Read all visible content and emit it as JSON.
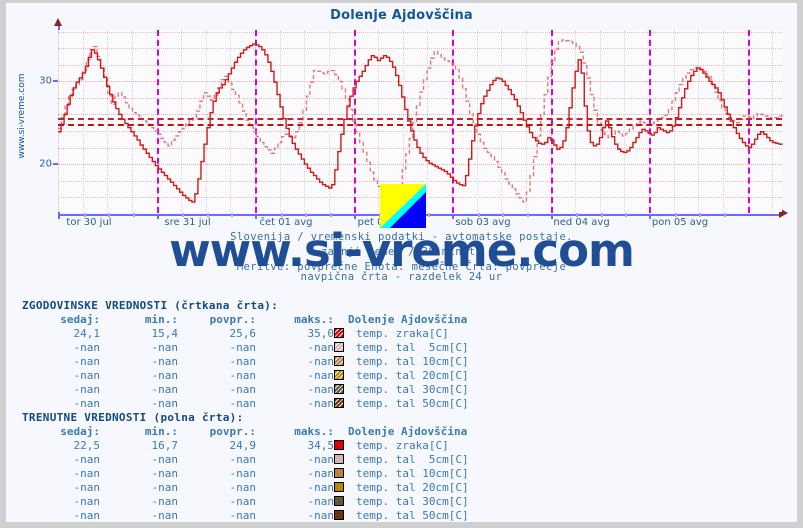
{
  "page": {
    "title": "Dolenje Ajdovščina",
    "vertical_watermark": "www.si-vreme.com",
    "watermark": "www.si-vreme.com"
  },
  "subtitle": {
    "line1": "Slovenija / vremenski podatki - avtomatske postaje.",
    "line2": "zadnji teden / 30 minut.",
    "line3": "Meritve: povprečne  Enota: mesečne  Črta: povprečje",
    "line4": "navpična črta - razdelek 24 ur"
  },
  "chart_data": {
    "type": "line",
    "title": "Dolenje Ajdovščina",
    "xlabel": "",
    "ylabel": "temp. zraka[C]",
    "ylim": [
      14.2,
      36.2
    ],
    "yticks": [
      20,
      30
    ],
    "ytick_labels": [
      "20",
      "30"
    ],
    "grid": true,
    "legend_position": "below-table",
    "x_tick_labels": [
      "tor 30 jul",
      "sre 31 jul",
      "čet 01 avg",
      "pet 02 avg",
      "sob 03 avg",
      "ned 04 avg",
      "pon 05 avg"
    ],
    "day_separator_note": "navpična črta - razdelek 24 ur",
    "average_lines": [
      {
        "name": "zgodovinsko povprečje",
        "value": 25.6,
        "style": "dashed",
        "color": "#cc2222"
      },
      {
        "name": "trenutno povprečje",
        "value": 24.9,
        "style": "dashed",
        "color": "#bb1414"
      }
    ],
    "series": [
      {
        "name": "temp. zraka[C] - zgodovinske vrednosti",
        "style": "dashed",
        "color": "#e87878",
        "values": [
          24.3,
          25.6,
          27.0,
          28.1,
          29.0,
          29.6,
          30.2,
          31.3,
          32.6,
          33.8,
          34.2,
          33.0,
          31.6,
          30.3,
          28.6,
          27.2,
          28.2,
          28.6,
          28.1,
          27.4,
          26.7,
          26.2,
          25.9,
          25.5,
          25.2,
          24.8,
          24.4,
          24.0,
          23.6,
          23.1,
          22.6,
          22.2,
          22.9,
          23.4,
          23.9,
          24.3,
          24.8,
          25.3,
          25.6,
          26.4,
          27.6,
          28.6,
          28.2,
          27.7,
          28.3,
          29.2,
          30.2,
          30.6,
          29.8,
          29.0,
          28.3,
          27.4,
          26.4,
          25.3,
          24.5,
          23.9,
          23.3,
          22.6,
          22.1,
          21.7,
          21.3,
          21.9,
          22.6,
          23.3,
          23.6,
          23.4,
          23.2,
          23.9,
          25.0,
          26.5,
          28.2,
          29.9,
          31.3,
          31.2,
          31.0,
          30.9,
          31.2,
          31.3,
          30.8,
          30.0,
          29.1,
          27.9,
          26.6,
          25.2,
          23.9,
          22.6,
          21.4,
          20.2,
          19.0,
          18.1,
          17.3,
          16.6,
          15.8,
          15.2,
          14.9,
          15.8,
          17.4,
          19.3,
          21.2,
          23.1,
          25.0,
          27.0,
          28.7,
          30.2,
          31.6,
          32.8,
          33.6,
          33.2,
          32.8,
          32.5,
          32.4,
          32.1,
          31.4,
          30.4,
          29.1,
          27.6,
          26.1,
          24.8,
          23.6,
          22.6,
          21.9,
          21.4,
          20.9,
          20.3,
          19.6,
          18.9,
          18.2,
          17.6,
          17.0,
          16.4,
          15.9,
          15.4,
          16.6,
          18.6,
          20.9,
          23.4,
          26.0,
          28.4,
          30.5,
          32.3,
          33.9,
          34.8,
          35.0,
          34.9,
          34.8,
          34.6,
          34.2,
          33.5,
          32.2,
          30.4,
          28.4,
          26.5,
          25.0,
          24.1,
          23.6,
          23.2,
          23.6,
          24.0,
          23.8,
          23.4,
          23.7,
          24.2,
          24.6,
          24.9,
          25.2,
          25.0,
          24.8,
          24.9,
          25.2,
          25.5,
          25.6,
          25.9,
          26.6,
          27.6,
          28.6,
          29.6,
          30.4,
          31.0,
          31.4,
          31.6,
          31.7,
          31.5,
          31.2,
          30.6,
          29.7,
          28.7,
          27.7,
          26.8,
          26.1,
          25.6,
          25.2,
          25.0,
          25.4,
          25.8,
          25.7,
          25.5,
          25.8,
          26.1,
          26.0,
          25.8,
          25.6,
          25.5,
          25.6,
          25.8,
          26.0
        ]
      },
      {
        "name": "temp. zraka[C] - trenutne vrednosti",
        "style": "solid",
        "color": "#d41919",
        "values": [
          23.9,
          24.8,
          26.0,
          27.2,
          28.3,
          29.2,
          29.9,
          30.4,
          31.0,
          31.8,
          32.9,
          33.8,
          33.4,
          32.6,
          31.6,
          30.5,
          29.4,
          28.4,
          27.5,
          26.7,
          26.0,
          25.4,
          24.9,
          24.4,
          23.9,
          23.4,
          22.9,
          22.3,
          21.8,
          21.3,
          20.8,
          20.3,
          19.8,
          19.4,
          19.0,
          18.6,
          18.2,
          17.8,
          17.4,
          17.0,
          16.6,
          16.2,
          15.9,
          15.6,
          15.4,
          16.4,
          18.2,
          20.3,
          22.4,
          24.4,
          26.2,
          27.6,
          28.6,
          29.2,
          29.6,
          30.2,
          30.9,
          31.6,
          32.3,
          32.9,
          33.4,
          33.8,
          34.1,
          34.3,
          34.5,
          34.4,
          34.2,
          33.8,
          33.2,
          32.3,
          31.2,
          29.9,
          28.4,
          26.9,
          25.5,
          24.3,
          23.3,
          22.5,
          21.8,
          21.2,
          20.6,
          20.0,
          19.5,
          19.0,
          18.6,
          18.2,
          17.8,
          17.5,
          17.3,
          17.1,
          17.5,
          19.3,
          21.5,
          23.6,
          25.4,
          27.0,
          28.2,
          29.2,
          30.0,
          30.6,
          31.2,
          31.9,
          32.6,
          33.1,
          32.9,
          32.5,
          32.8,
          33.1,
          32.9,
          32.4,
          31.7,
          30.7,
          29.5,
          28.1,
          26.6,
          25.2,
          24.0,
          22.9,
          22.0,
          21.3,
          20.8,
          20.4,
          20.1,
          19.9,
          19.7,
          19.5,
          19.3,
          19.1,
          18.8,
          18.4,
          18.0,
          17.7,
          17.5,
          17.4,
          18.6,
          20.6,
          22.8,
          24.6,
          26.1,
          27.3,
          28.2,
          28.9,
          29.6,
          30.1,
          30.4,
          30.3,
          30.0,
          29.5,
          29.0,
          28.4,
          27.8,
          27.0,
          26.2,
          25.3,
          24.5,
          23.8,
          23.2,
          22.8,
          22.5,
          22.4,
          22.6,
          23.2,
          22.9,
          22.3,
          21.8,
          22.0,
          22.8,
          24.4,
          26.8,
          29.2,
          31.2,
          32.6,
          31.0,
          27.0,
          24.0,
          22.6,
          22.2,
          22.4,
          23.2,
          24.4,
          25.2,
          24.4,
          23.3,
          22.4,
          21.8,
          21.5,
          21.4,
          21.6,
          22.0,
          22.6,
          23.2,
          23.8,
          24.2,
          24.0,
          23.7,
          23.5,
          23.8,
          24.4,
          24.2,
          24.0,
          23.8,
          24.0,
          24.6,
          25.6,
          26.8,
          28.0,
          29.1,
          30.0,
          30.7,
          31.2,
          31.6,
          31.4,
          31.0,
          30.5,
          30.0,
          29.6,
          29.2,
          28.6,
          27.8,
          26.9,
          26.0,
          25.2,
          24.4,
          23.7,
          23.1,
          22.6,
          22.2,
          22.0,
          22.4,
          23.0,
          23.6,
          23.9,
          23.6,
          23.2,
          22.8,
          22.6,
          22.5,
          22.4,
          22.5
        ]
      }
    ]
  },
  "tables": [
    {
      "section": "ZGODOVINSKE VREDNOSTI (črtkana črta):",
      "headers": [
        "sedaj:",
        "min.:",
        "povpr.:",
        "maks.:",
        "Dolenje Ajdovščina"
      ],
      "style": "hatch",
      "rows": [
        {
          "sedaj": "24,1",
          "min": "15,4",
          "povpr": "25,6",
          "maks": "35,0",
          "color": "#e00000",
          "label": "temp. zraka[C]"
        },
        {
          "sedaj": "-nan",
          "min": "-nan",
          "povpr": "-nan",
          "maks": "-nan",
          "color": "#d9b3b3",
          "label": "temp. tal  5cm[C]"
        },
        {
          "sedaj": "-nan",
          "min": "-nan",
          "povpr": "-nan",
          "maks": "-nan",
          "color": "#c08040",
          "label": "temp. tal 10cm[C]"
        },
        {
          "sedaj": "-nan",
          "min": "-nan",
          "povpr": "-nan",
          "maks": "-nan",
          "color": "#c08800",
          "label": "temp. tal 20cm[C]"
        },
        {
          "sedaj": "-nan",
          "min": "-nan",
          "povpr": "-nan",
          "maks": "-nan",
          "color": "#605a37",
          "label": "temp. tal 30cm[C]"
        },
        {
          "sedaj": "-nan",
          "min": "-nan",
          "povpr": "-nan",
          "maks": "-nan",
          "color": "#6b3410",
          "label": "temp. tal 50cm[C]"
        }
      ]
    },
    {
      "section": "TRENUTNE VREDNOSTI (polna črta):",
      "headers": [
        "sedaj:",
        "min.:",
        "povpr.:",
        "maks.:",
        "Dolenje Ajdovščina"
      ],
      "style": "solid",
      "rows": [
        {
          "sedaj": "22,5",
          "min": "16,7",
          "povpr": "24,9",
          "maks": "34,5",
          "color": "#e00000",
          "label": "temp. zraka[C]"
        },
        {
          "sedaj": "-nan",
          "min": "-nan",
          "povpr": "-nan",
          "maks": "-nan",
          "color": "#d9b3b3",
          "label": "temp. tal  5cm[C]"
        },
        {
          "sedaj": "-nan",
          "min": "-nan",
          "povpr": "-nan",
          "maks": "-nan",
          "color": "#c08040",
          "label": "temp. tal 10cm[C]"
        },
        {
          "sedaj": "-nan",
          "min": "-nan",
          "povpr": "-nan",
          "maks": "-nan",
          "color": "#c08800",
          "label": "temp. tal 20cm[C]"
        },
        {
          "sedaj": "-nan",
          "min": "-nan",
          "povpr": "-nan",
          "maks": "-nan",
          "color": "#605a37",
          "label": "temp. tal 30cm[C]"
        },
        {
          "sedaj": "-nan",
          "min": "-nan",
          "povpr": "-nan",
          "maks": "-nan",
          "color": "#6b3410",
          "label": "temp. tal 50cm[C]"
        }
      ]
    }
  ],
  "colors": {
    "accent": "#15559a",
    "historical_line": "#e87878",
    "current_line": "#d41919",
    "day_separator": "#d900d9",
    "axis": "#6a6aff",
    "grid": "#e8b9b9",
    "background": "#f7f8fd",
    "logo_yellow": "#ffff00",
    "logo_cyan": "#00ffff",
    "logo_blue": "#0000ff"
  }
}
